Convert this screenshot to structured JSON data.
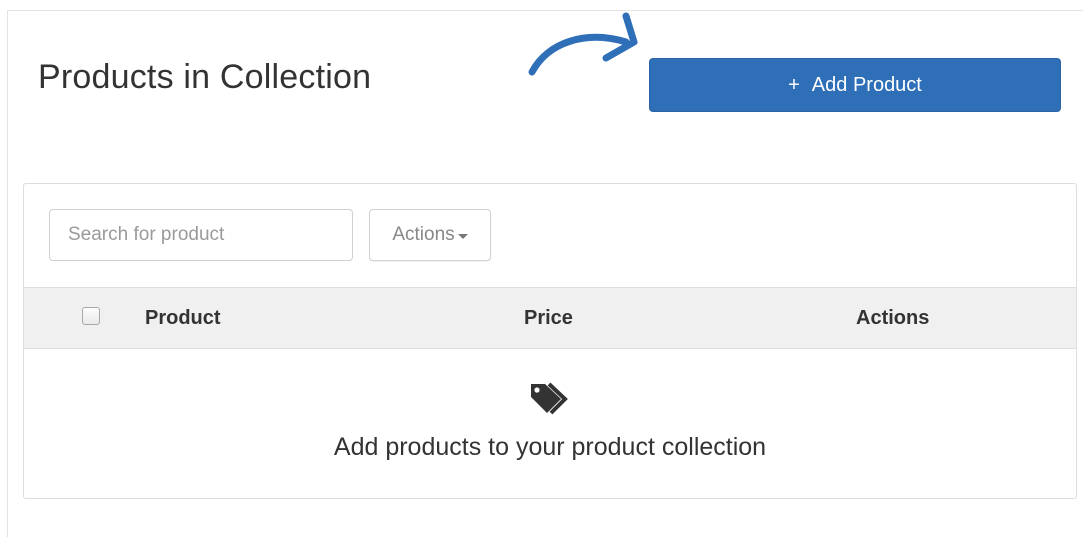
{
  "header": {
    "title": "Products in Collection",
    "add_button": {
      "icon": "plus-icon",
      "plus": "+",
      "label": "Add Product"
    }
  },
  "toolbar": {
    "search_placeholder": "Search for product",
    "actions_label": "Actions"
  },
  "table": {
    "columns": [
      "Product",
      "Price",
      "Actions"
    ]
  },
  "empty_state": {
    "icon": "tags-icon",
    "message": "Add products to your product collection"
  },
  "colors": {
    "primary": "#2f6fb8",
    "annotation_arrow": "#2f6fb8",
    "table_header_bg": "#f0f0f0"
  }
}
